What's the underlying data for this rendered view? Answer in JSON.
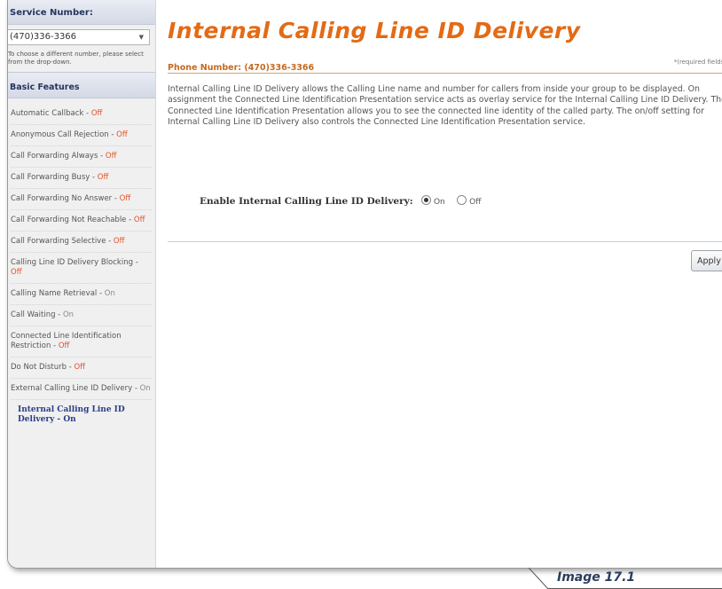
{
  "sidebar": {
    "service_number_label": "Service Number:",
    "service_number_value": "(470)336-3366",
    "service_number_note": "To choose a different number, please select from the drop-down.",
    "basic_features_label": "Basic Features",
    "features": [
      {
        "name": "Automatic Callback - ",
        "state": "Off"
      },
      {
        "name": "Anonymous Call Rejection - ",
        "state": "Off"
      },
      {
        "name": "Call Forwarding Always - ",
        "state": "Off"
      },
      {
        "name": "Call Forwarding Busy - ",
        "state": "Off"
      },
      {
        "name": "Call Forwarding No Answer - ",
        "state": "Off"
      },
      {
        "name": "Call Forwarding Not Reachable - ",
        "state": "Off"
      },
      {
        "name": "Call Forwarding Selective - ",
        "state": "Off"
      },
      {
        "name": "Calling Line ID Delivery Blocking - ",
        "state": "Off"
      },
      {
        "name": "Calling Name Retrieval - ",
        "state": "On"
      },
      {
        "name": "Call Waiting - ",
        "state": "On"
      },
      {
        "name": "Connected Line Identification Restriction - ",
        "state": "Off"
      },
      {
        "name": "Do Not Disturb - ",
        "state": "Off"
      },
      {
        "name": "External Calling Line ID Delivery - ",
        "state": "On"
      },
      {
        "name": "Internal Calling Line ID Delivery - ",
        "state": "On"
      }
    ]
  },
  "main": {
    "title": "Internal Calling Line ID Delivery",
    "phone_label": "Phone Number: (470)336-3366",
    "required_note": "*(required fields)",
    "description": "Internal Calling Line ID Delivery allows the Calling Line name and number for callers from inside your group to be displayed. On assignment the Connected Line Identification Presentation service acts as overlay service for the Internal Calling Line ID Delivery. The Connected Line Identification Presentation allows you to see the connected line identity of the called party. The on/off setting for Internal Calling Line ID Delivery also controls the Connected Line Identification Presentation service.",
    "enable_label": "Enable Internal Calling Line ID Delivery:",
    "option_on": "On",
    "option_off": "Off",
    "selected": "On",
    "apply_label": "Apply"
  },
  "caption": "Image 17.1",
  "colors": {
    "title_orange": "#e46a14",
    "off_red": "#e2512a",
    "nav_blue": "#26355e",
    "active_blue": "#2b3f87"
  }
}
